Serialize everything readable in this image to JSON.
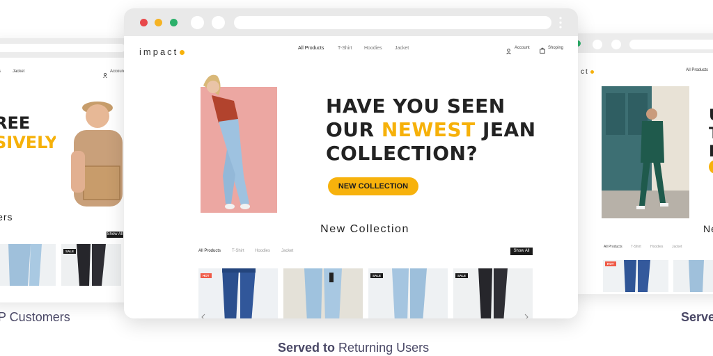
{
  "left_window": {
    "nav": [
      "lies",
      "Jacket"
    ],
    "account_label": "Account",
    "headline_line1": "REE",
    "headline_line2": "SIVELY",
    "section_title": "lers",
    "show_all": "Show All",
    "badge": "SALE"
  },
  "main_window": {
    "logo": "impact",
    "nav": [
      "All Products",
      "T-Shirt",
      "Hoodies",
      "Jacket"
    ],
    "account_label": "Account",
    "shopping_label": "Shoping",
    "hero": {
      "line1": "HAVE YOU SEEN",
      "line2_pre": "OUR",
      "line2_highlight": "NEWEST",
      "line2_post": "JEAN",
      "line3": "COLLECTION?",
      "cta": "NEW COLLECTION"
    },
    "section_title": "New Collection",
    "filter_tabs": [
      "All Products",
      "T-Shirt",
      "Hoodies",
      "Jacket"
    ],
    "show_all": "Show All",
    "badges": [
      "HOT",
      "SALE",
      "SALE"
    ]
  },
  "right_window": {
    "logo_partial": "ct",
    "nav_first": "All Products",
    "section_title": "Ne",
    "filter_tabs": [
      "All Products",
      "T-Shirt",
      "Hoodies",
      "Jacket"
    ],
    "badge": "HOT"
  },
  "captions": {
    "left": "P Customers",
    "center_bold": "Served to",
    "center_rest": "Returning Users",
    "right": "Serve"
  },
  "colors": {
    "accent": "#f7b20c",
    "caption": "#4a4866",
    "traffic_red": "#e8484a",
    "traffic_yellow": "#f5b324",
    "traffic_green": "#2bb06a"
  }
}
